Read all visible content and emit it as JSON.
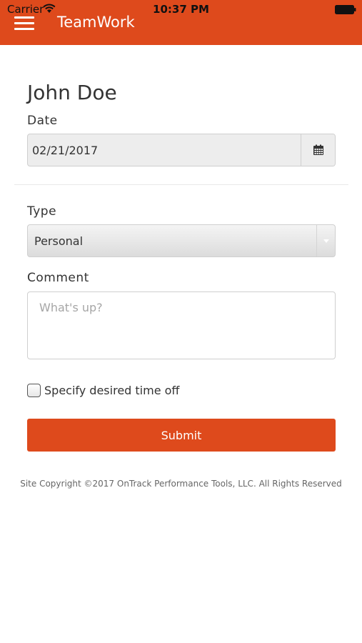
{
  "statusbar": {
    "carrier": "Carrier",
    "time": "10:37 PM"
  },
  "header": {
    "title": "TeamWork",
    "menu_icon": "hamburger-menu-icon",
    "background_color": "#de4a1c"
  },
  "form": {
    "user_name": "John Doe",
    "date_label": "Date",
    "date_value": "02/21/2017",
    "calendar_icon": "calendar-icon",
    "type_label": "Type",
    "type_selected": "Personal",
    "comment_label": "Comment",
    "comment_placeholder": "What's up?",
    "checkbox_label": "Specify desired time off",
    "checkbox_checked": false,
    "submit_label": "Submit",
    "accent_color": "#de4a1c"
  },
  "footer": {
    "copyright": "Site Copyright ©2017 OnTrack Performance Tools, LLC. All Rights Reserved"
  }
}
